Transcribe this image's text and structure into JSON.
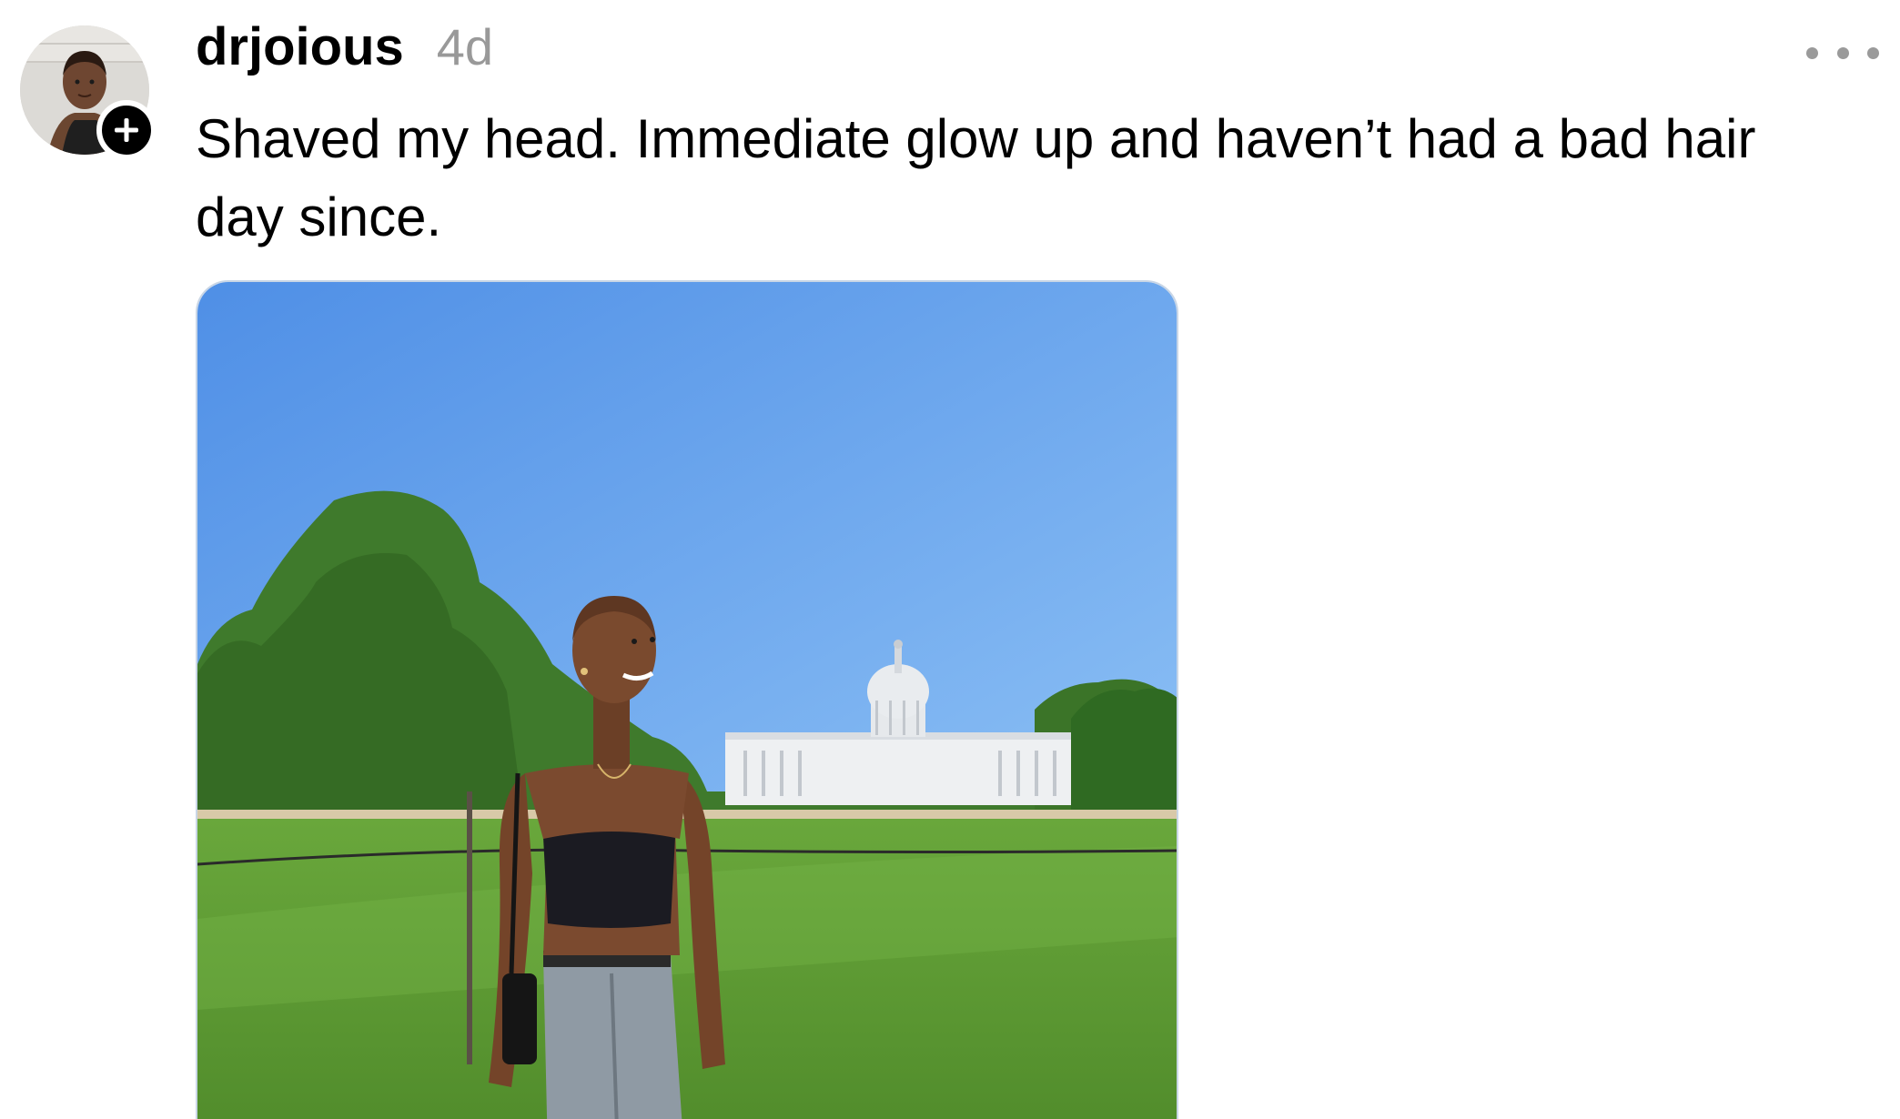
{
  "post": {
    "author": {
      "username": "drjoious",
      "avatar_icon": "profile-photo",
      "follow_icon": "plus-icon"
    },
    "timestamp": "4d",
    "more_icon": "ellipsis-icon",
    "caption": "Shaved my head. Immediate glow up and haven’t had a bad hair day since.",
    "photo_icon": "photo-woman-shaved-head-capitol"
  },
  "colors": {
    "text_primary": "#000000",
    "text_secondary": "#999999",
    "sky": "#5fa0ea",
    "grass": "#5c9a34"
  }
}
